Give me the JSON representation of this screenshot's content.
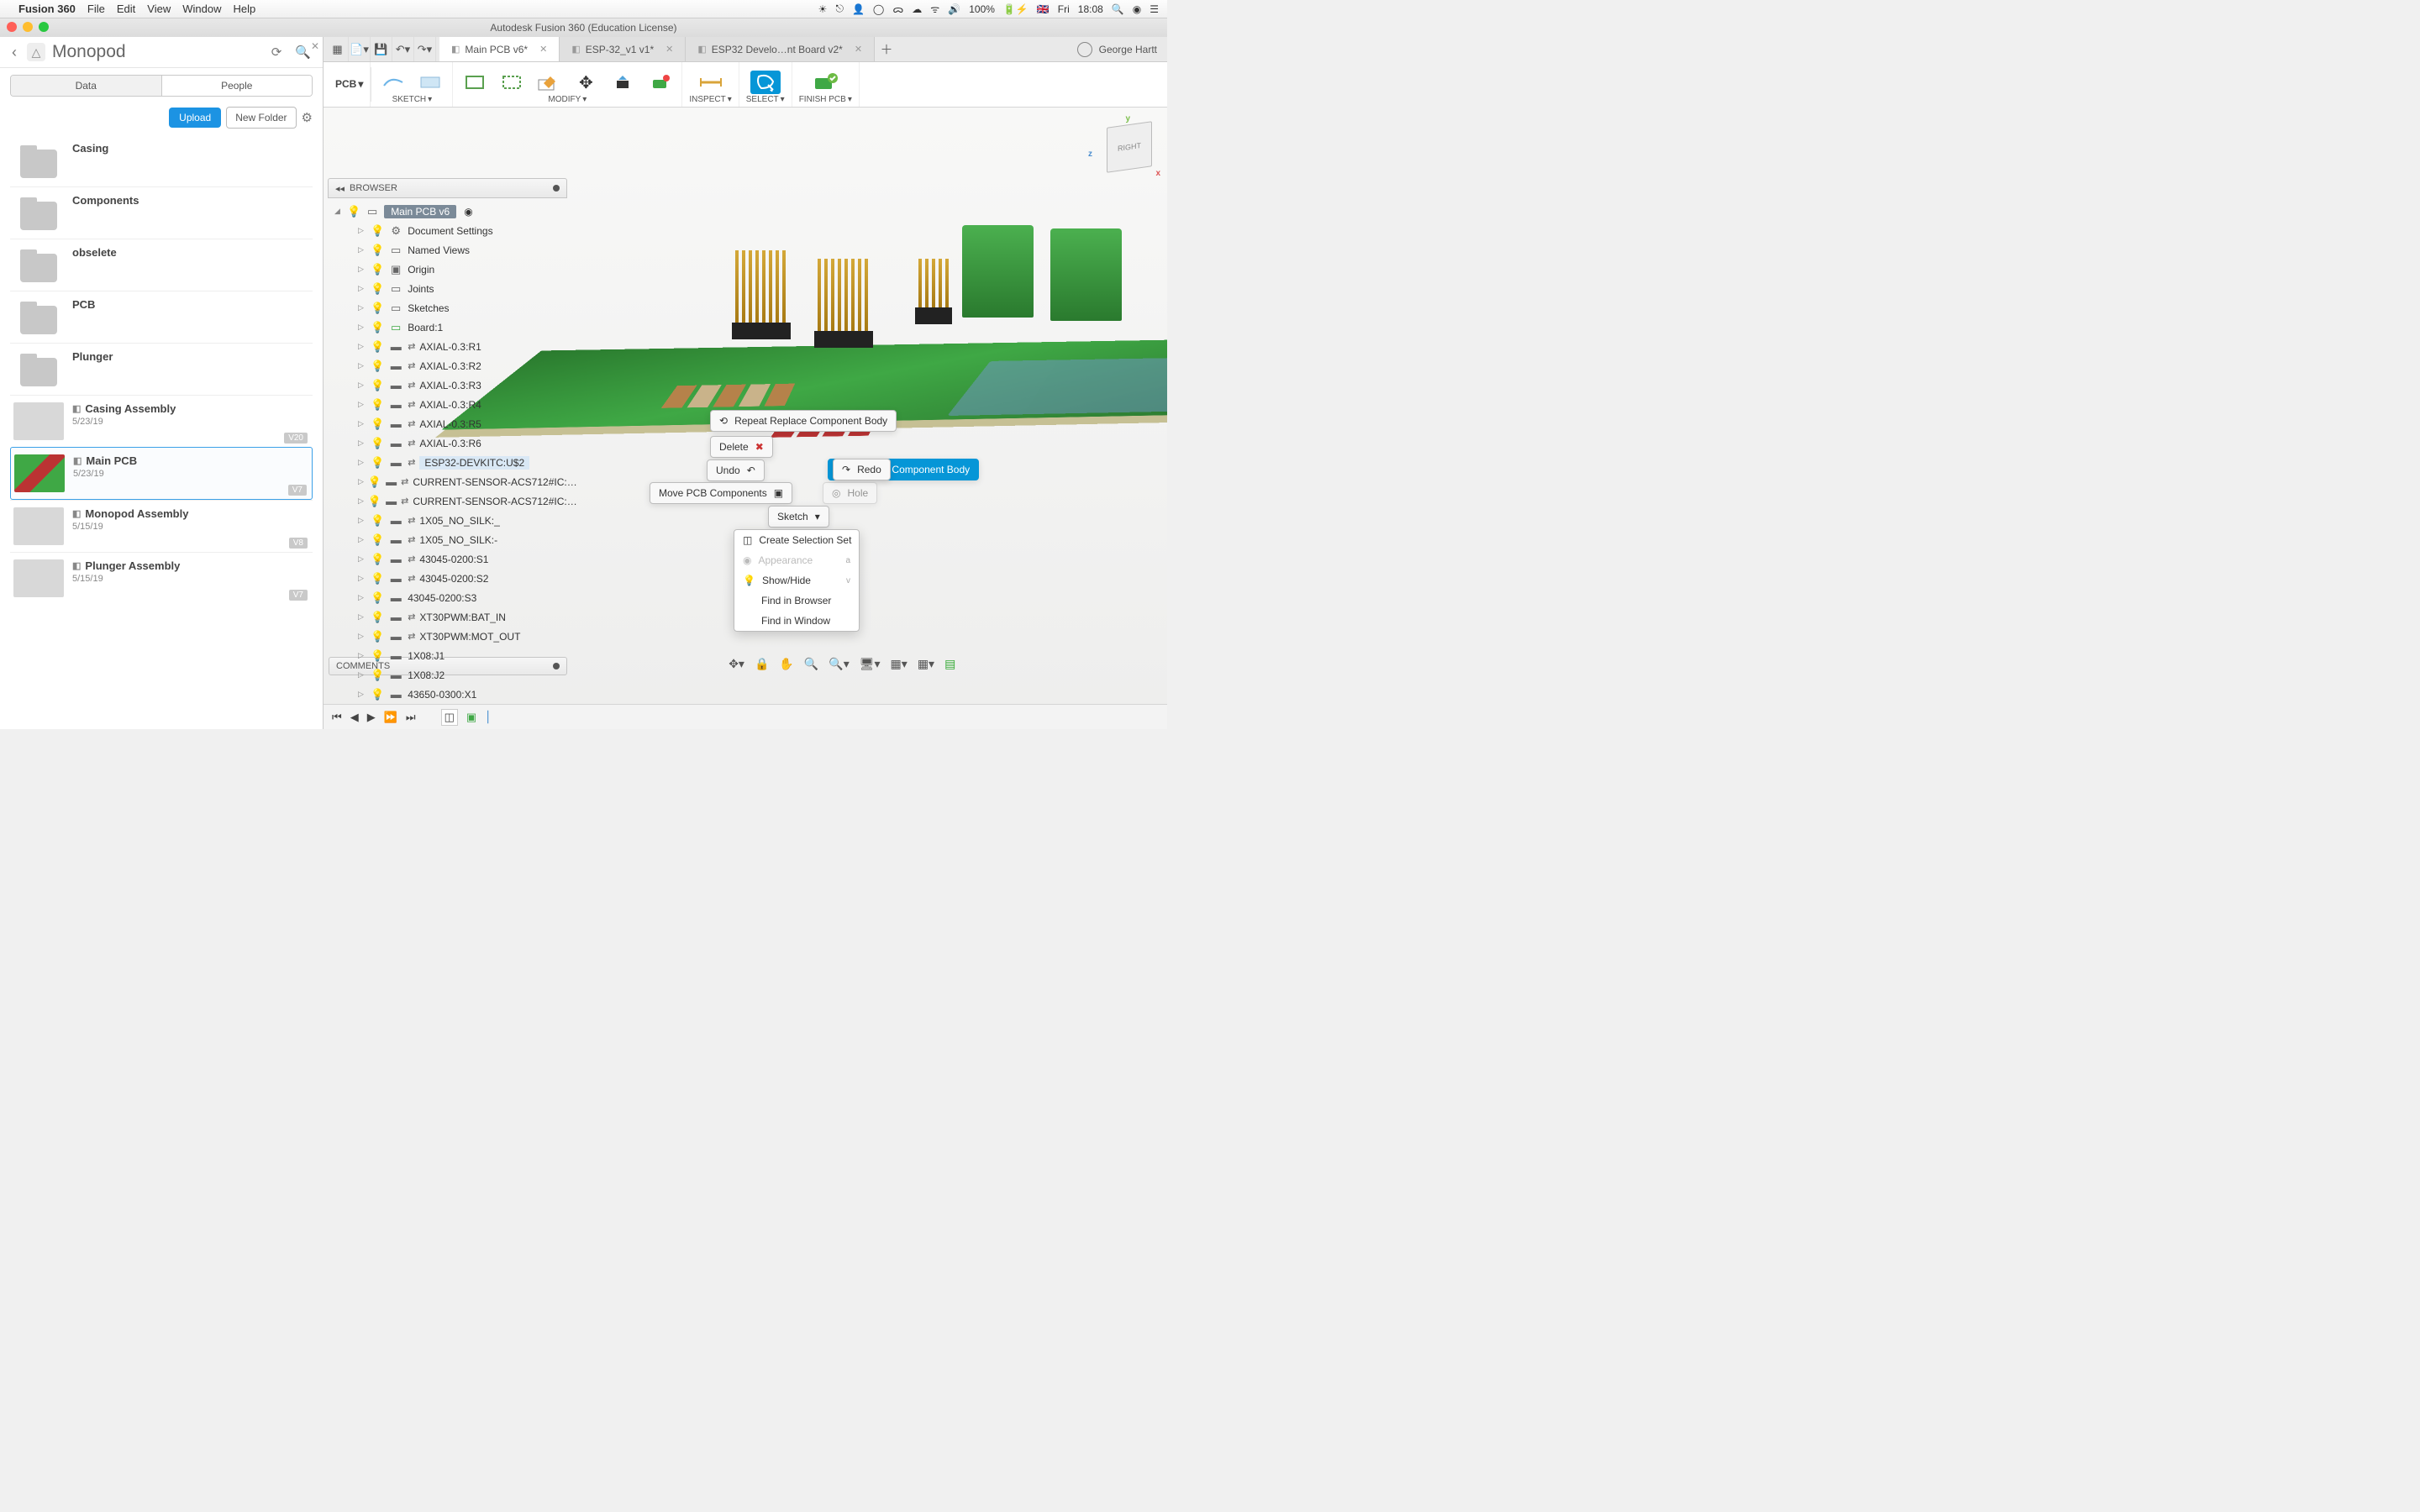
{
  "menubar": {
    "app": "Fusion 360",
    "items": [
      "File",
      "Edit",
      "View",
      "Window",
      "Help"
    ],
    "battery": "100%",
    "flag": "🇬🇧",
    "day": "Fri",
    "time": "18:08"
  },
  "window": {
    "title": "Autodesk Fusion 360 (Education License)"
  },
  "datapanel": {
    "project": "Monopod",
    "seg_data": "Data",
    "seg_people": "People",
    "upload": "Upload",
    "newfolder": "New Folder",
    "items": [
      {
        "type": "folder",
        "name": "Casing"
      },
      {
        "type": "folder",
        "name": "Components"
      },
      {
        "type": "folder",
        "name": "obselete"
      },
      {
        "type": "folder",
        "name": "PCB"
      },
      {
        "type": "folder",
        "name": "Plunger"
      },
      {
        "type": "design",
        "name": "Casing Assembly",
        "date": "5/23/19",
        "ver": "V20"
      },
      {
        "type": "design",
        "name": "Main PCB",
        "date": "5/23/19",
        "ver": "V7",
        "selected": true
      },
      {
        "type": "design",
        "name": "Monopod Assembly",
        "date": "5/15/19",
        "ver": "V8"
      },
      {
        "type": "design",
        "name": "Plunger Assembly",
        "date": "5/15/19",
        "ver": "V7"
      }
    ]
  },
  "tabs": {
    "user": "George Hartt",
    "items": [
      {
        "label": "Main PCB v6*",
        "active": true
      },
      {
        "label": "ESP-32_v1 v1*"
      },
      {
        "label": "ESP32 Develo…nt Board v2*"
      }
    ]
  },
  "toolbar": {
    "workspace": "PCB",
    "groups": {
      "sketch": "SKETCH",
      "modify": "MODIFY",
      "inspect": "INSPECT",
      "select": "SELECT",
      "finish": "FINISH PCB"
    }
  },
  "browser": {
    "title": "BROWSER",
    "root": "Main PCB v6",
    "nodes": [
      {
        "label": "Document Settings",
        "icon": "⚙"
      },
      {
        "label": "Named Views",
        "icon": "▭"
      },
      {
        "label": "Origin",
        "icon": "▣",
        "bulb": "off"
      },
      {
        "label": "Joints",
        "icon": "▭"
      },
      {
        "label": "Sketches",
        "icon": "▭"
      },
      {
        "label": "Board:1",
        "icon": "board"
      },
      {
        "label": "AXIAL-0.3:R1",
        "icon": "chip",
        "link": true,
        "boxed": true
      },
      {
        "label": "AXIAL-0.3:R2",
        "icon": "chip",
        "link": true
      },
      {
        "label": "AXIAL-0.3:R3",
        "icon": "chip",
        "link": true,
        "boxed": true
      },
      {
        "label": "AXIAL-0.3:R4",
        "icon": "chip",
        "link": true
      },
      {
        "label": "AXIAL-0.3:R5",
        "icon": "chip",
        "link": true
      },
      {
        "label": "AXIAL-0.3:R6",
        "icon": "chip",
        "link": true
      },
      {
        "label": "ESP32-DEVKITC:U$2",
        "icon": "chip",
        "link": true,
        "sel": true
      },
      {
        "label": "CURRENT-SENSOR-ACS712#IC:…",
        "icon": "chip",
        "link": true
      },
      {
        "label": "CURRENT-SENSOR-ACS712#IC:…",
        "icon": "chip",
        "link": true
      },
      {
        "label": "1X05_NO_SILK:_",
        "icon": "chip",
        "link": true
      },
      {
        "label": "1X05_NO_SILK:-",
        "icon": "chip",
        "link": true
      },
      {
        "label": "43045-0200:S1",
        "icon": "chip",
        "link": true
      },
      {
        "label": "43045-0200:S2",
        "icon": "chip",
        "link": true
      },
      {
        "label": "43045-0200:S3",
        "icon": "chip"
      },
      {
        "label": "XT30PWM:BAT_IN",
        "icon": "chip",
        "link": true
      },
      {
        "label": "XT30PWM:MOT_OUT",
        "icon": "chip",
        "link": true
      },
      {
        "label": "1X08:J1",
        "icon": "chip"
      },
      {
        "label": "1X08:J2",
        "icon": "chip"
      },
      {
        "label": "43650-0300:X1",
        "icon": "chip"
      }
    ]
  },
  "context": {
    "repeat": "Repeat Replace Component Body",
    "delete": "Delete",
    "replace": "Replace Component Body",
    "undo": "Undo",
    "redo": "Redo",
    "move": "Move PCB Components",
    "hole": "Hole",
    "sketch": "Sketch",
    "menu": [
      {
        "label": "Create Selection Set",
        "icon": "◫"
      },
      {
        "label": "Appearance",
        "icon": "◉",
        "kb": "a",
        "disabled": true
      },
      {
        "label": "Show/Hide",
        "icon": "💡",
        "kb": "v"
      },
      {
        "label": "Find in Browser"
      },
      {
        "label": "Find in Window"
      }
    ]
  },
  "comments": {
    "title": "COMMENTS"
  },
  "viewcube": {
    "face": "RIGHT",
    "x": "x",
    "y": "y",
    "z": "z"
  }
}
